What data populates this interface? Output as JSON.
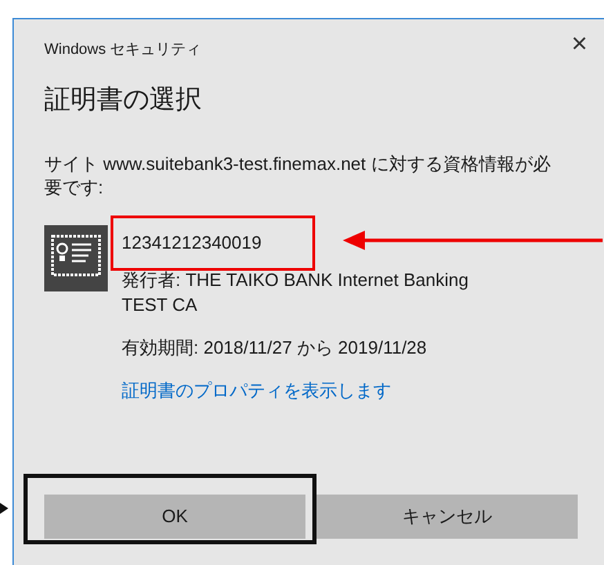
{
  "window": {
    "title": "Windows セキュリティ",
    "close": "×"
  },
  "heading": "証明書の選択",
  "message": "サイト www.suitebank3-test.finemax.net に対する資格情報が必要です:",
  "certificate": {
    "name": "12341212340019",
    "highlighted": true,
    "issuer": "発行者: THE TAIKO BANK Internet Banking TEST CA",
    "validity": "有効期間: 2018/11/27 から 2019/11/28",
    "link": "証明書のプロパティを表示します"
  },
  "buttons": [
    {
      "label": "OK",
      "highlighted": true
    },
    {
      "label": "キャンセル",
      "highlighted": false
    }
  ]
}
